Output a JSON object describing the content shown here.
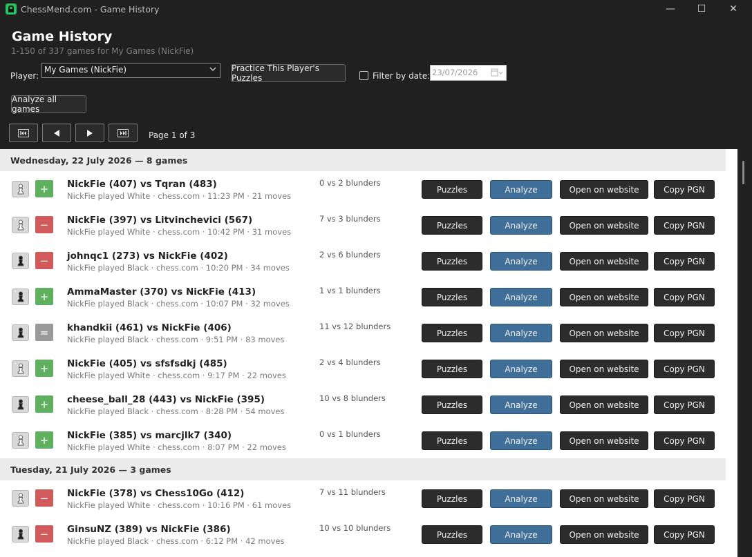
{
  "window": {
    "title": "ChessMend.com - Game History",
    "controls": [
      "—",
      "☐",
      "✕"
    ]
  },
  "header": {
    "title": "Game History",
    "subtitle": "1-150 of 337 games for My Games (NickFie)",
    "player_label": "Player:",
    "player_value": "My Games (NickFie)",
    "practice_button": "Practice This Player's Puzzles",
    "filter_label": "Filter by date:",
    "filter_checked": false,
    "date_value": "23/07/2026",
    "analyze_all_button": "Analyze all games",
    "page_text": "Page 1 of 3"
  },
  "buttons": {
    "puzzles": "Puzzles",
    "analyze": "Analyze",
    "open": "Open on website",
    "copy": "Copy PGN"
  },
  "days": [
    {
      "label": "Wednesday, 22 July 2026 — 8 games",
      "games": [
        {
          "title": "NickFie (407) vs Tqran (483)",
          "meta": "NickFie played White · chess.com · 11:23 PM · 21 moves",
          "blunders": "0 vs 2 blunders",
          "result": "+",
          "result_kind": "win",
          "color": "white"
        },
        {
          "title": "NickFie (397) vs Litvinchevici (567)",
          "meta": "NickFie played White · chess.com · 10:42 PM · 31 moves",
          "blunders": "7 vs 3 blunders",
          "result": "−",
          "result_kind": "loss",
          "color": "white"
        },
        {
          "title": "johnqc1 (273) vs NickFie (402)",
          "meta": "NickFie played Black · chess.com · 10:20 PM · 34 moves",
          "blunders": "2 vs 6 blunders",
          "result": "−",
          "result_kind": "loss",
          "color": "black"
        },
        {
          "title": "AmmaMaster (370) vs NickFie (413)",
          "meta": "NickFie played Black · chess.com · 10:07 PM · 32 moves",
          "blunders": "1 vs 1 blunders",
          "result": "+",
          "result_kind": "win",
          "color": "black"
        },
        {
          "title": "khandkii (461) vs NickFie (406)",
          "meta": "NickFie played Black · chess.com · 9:51 PM · 83 moves",
          "blunders": "11 vs 12 blunders",
          "result": "=",
          "result_kind": "draw",
          "color": "black"
        },
        {
          "title": "NickFie (405) vs sfsfsdkj (485)",
          "meta": "NickFie played White · chess.com · 9:17 PM · 22 moves",
          "blunders": "2 vs 4 blunders",
          "result": "+",
          "result_kind": "win",
          "color": "white"
        },
        {
          "title": "cheese_ball_28 (443) vs NickFie (395)",
          "meta": "NickFie played Black · chess.com · 8:28 PM · 54 moves",
          "blunders": "10 vs 8 blunders",
          "result": "+",
          "result_kind": "win",
          "color": "black"
        },
        {
          "title": "NickFie (385) vs marcjlk7 (340)",
          "meta": "NickFie played White · chess.com · 8:07 PM · 22 moves",
          "blunders": "0 vs 1 blunders",
          "result": "+",
          "result_kind": "win",
          "color": "white"
        }
      ]
    },
    {
      "label": "Tuesday, 21 July 2026 — 3 games",
      "games": [
        {
          "title": "NickFie (378) vs Chess10Go (412)",
          "meta": "NickFie played White · chess.com · 10:16 PM · 61 moves",
          "blunders": "7 vs 11 blunders",
          "result": "−",
          "result_kind": "loss",
          "color": "white"
        },
        {
          "title": "GinsuNZ (389) vs NickFie (386)",
          "meta": "NickFie played Black · chess.com · 6:12 PM · 42 moves",
          "blunders": "10 vs 10 blunders",
          "result": "−",
          "result_kind": "loss",
          "color": "black"
        }
      ]
    }
  ],
  "colors": {
    "win": "#5fb05f",
    "loss": "#d25a5a",
    "draw": "#9a9a9a",
    "analyze": "#3f6f99"
  },
  "icons": {
    "pawn_white": "white-pawn-icon",
    "pawn_black": "black-pawn-icon",
    "first": "skip-to-first-icon",
    "prev": "triangle-left-icon",
    "next": "triangle-right-icon",
    "last": "skip-to-last-icon"
  }
}
